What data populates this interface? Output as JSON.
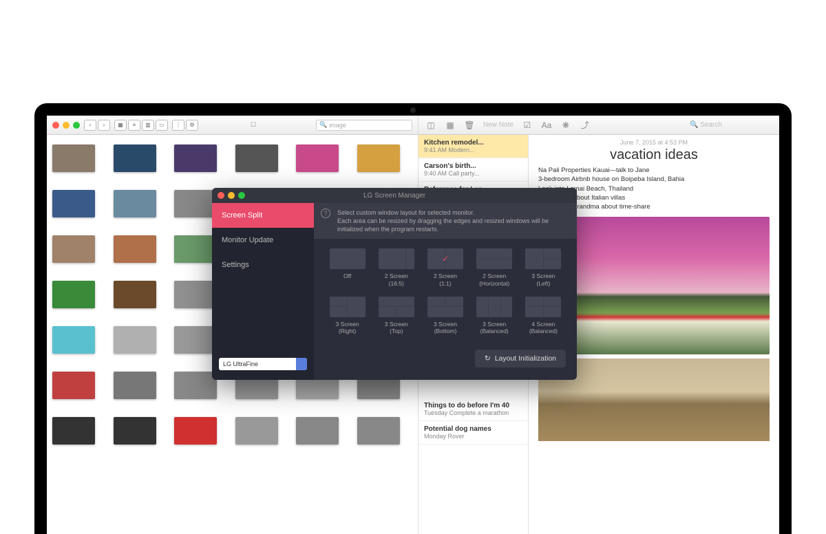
{
  "finder": {
    "search_label": "image",
    "dropbox_icon": "☐"
  },
  "notes": {
    "toolbar": {
      "new_note": "New Note",
      "search": "Search"
    },
    "list": [
      {
        "title": "Kitchen remodel...",
        "meta": "9:41 AM  Modern..."
      },
      {
        "title": "Carson's birth...",
        "meta": "9:40 AM  Call party..."
      },
      {
        "title": "Reference for Lee",
        "meta": ""
      },
      {
        "title": "Things to do before I'm 40",
        "meta": "Tuesday  Complete a marathon"
      },
      {
        "title": "Potential dog names",
        "meta": "Monday  Rover"
      }
    ],
    "content": {
      "date": "June 7, 2015 at 4:53 PM",
      "title": "vacation ideas",
      "lines": [
        "Na Pali Properties Kauai—talk to Jane",
        "3-bedroom Airbnb house on Boipeba Island, Bahia",
        "Look into Lamai Beach, Thailand",
        "Ask Christy about Italian villas",
        "Check with Grandma about time-share"
      ]
    }
  },
  "lg": {
    "title": "LG Screen Manager",
    "tabs": [
      "Screen Split",
      "Monitor Update",
      "Settings"
    ],
    "info_line1": "Select custom window layout for selected monitor.",
    "info_line2": "Each area can be resized by dragging the edges and resized windows will be initialized when the program restarts.",
    "monitor": "LG UltraFine",
    "options": [
      {
        "label": "Off"
      },
      {
        "label": "2 Screen\n(16:5)"
      },
      {
        "label": "2 Screen\n(1:1)"
      },
      {
        "label": "2 Screen\n(Horizontal)"
      },
      {
        "label": "3 Screen\n(Left)"
      },
      {
        "label": "3 Screen\n(Right)"
      },
      {
        "label": "3 Screen\n(Top)"
      },
      {
        "label": "3 Screen\n(Bottom)"
      },
      {
        "label": "3 Screen\n(Balanced)"
      },
      {
        "label": "4 Screen\n(Balanced)"
      }
    ],
    "reset": "Layout Initialization"
  },
  "thumb_colors": [
    "#8a7a6a",
    "#2a4a6a",
    "#4a3a6a",
    "#555",
    "#c94a8a",
    "#d4a040",
    "#3a5a8a",
    "#6a8aa0",
    "#888",
    "#707890",
    "#5a6a7a",
    "#999",
    "#a0826a",
    "#b0704a",
    "#6a9a6a",
    "#808080",
    "#4a7a3a",
    "#888",
    "#3a8a3a",
    "#6a4a2a",
    "#909090",
    "#707070",
    "#a04a4a",
    "#888",
    "#5ac0d0",
    "#b0b0b0",
    "#999",
    "#888",
    "#777",
    "#888",
    "#c04040",
    "#777",
    "#888",
    "#999",
    "#aaa",
    "#888",
    "#333",
    "#333",
    "#d03030",
    "#999",
    "#888",
    "#888"
  ]
}
